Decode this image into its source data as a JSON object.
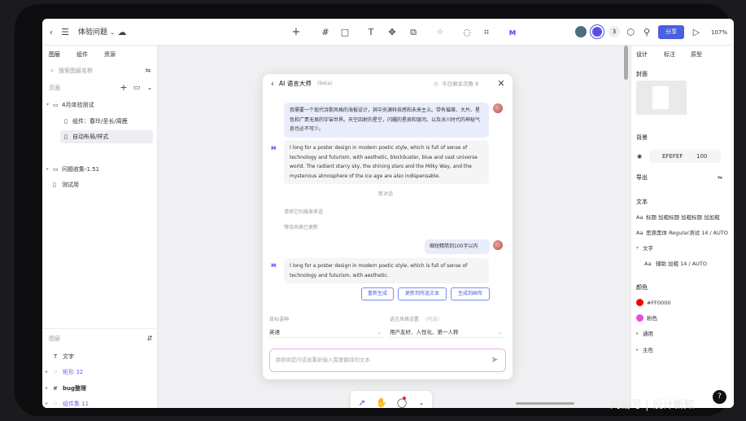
{
  "header": {
    "title": "体验问题",
    "share_label": "分享",
    "zoom": "107%",
    "collab_count": "3"
  },
  "left": {
    "tabs": [
      "图层",
      "组件",
      "资源"
    ],
    "search_placeholder": "搜索图层名称",
    "pages_label": "页面",
    "pages": [
      {
        "label": "4月体验测试"
      },
      {
        "label": "组件：春玲/圣长/周鹿"
      },
      {
        "label": "自动布局/样式"
      },
      {
        "label": "问题收集-1.51"
      },
      {
        "label": "测试用"
      }
    ],
    "layers_label": "图层",
    "layers": [
      {
        "label": "文字"
      },
      {
        "label": "矩形 32"
      },
      {
        "label": "bug整理"
      },
      {
        "label": "组件集 11"
      }
    ]
  },
  "dialog": {
    "title": "AI 语言大师",
    "title_badge": "(beta)",
    "usage": "今日剩余次数 8",
    "msg1_user": "我需要一个现代诗歌风格的海报设计，其中充满科技感和未来主义。带有璀璨、大片、星色和广袤无垠的宇宙世界。天空四射的星空，闪耀的星辰和银河。以及冰川时代的神秘气息也必不可少。",
    "msg1_ai": "I long for a poster design in modern poetic style, which is full of sense of technology and futurism, with aesthetic, blockbuster, blue and vast universe world. The radiant starry sky, the shining stars and the Milky Way, and the mysterious atmosphere of the ice age are also indispensable.",
    "divider": "新对话",
    "sys1": "请将它扫描发来送",
    "sys2": "等待风格已更新",
    "msg2_user": "缩短精简到100字以内",
    "msg2_ai": "I long for a poster design in modern poetic style, which is full of sense of technology and futurism, with aesthetic.",
    "btn_regen": "重新生成",
    "btn_replace": "更新到所选文本",
    "btn_newlayer": "生成到画布",
    "target_lang_label": "目标语种",
    "target_lang_value": "英语",
    "style_label": "语言风格设置",
    "style_hint": "(可选)",
    "style_value": "用户友好、人性化、第一人称",
    "input_placeholder": "请继续提问或者重新输入需要翻译的文本"
  },
  "right": {
    "tabs": [
      "设计",
      "标注",
      "原型"
    ],
    "cover_label": "封面",
    "bg_label": "背景",
    "bg_color": "EFEFEF",
    "bg_opacity": "100",
    "export_label": "导出",
    "text_label": "文本",
    "text_style1": "标题 加粗标题 加粗标题 加加粗",
    "text_style2": "思源黑体 Regular测试 14 / AUTO",
    "text_sub": "文字",
    "text_style3": "辅助 加粗 14 / AUTO",
    "color_label": "颜色",
    "color1": "#FF0000",
    "color2": "粉色",
    "group1": "通用",
    "group2": "主色"
  },
  "watermark": "网易号 | 设计新知"
}
